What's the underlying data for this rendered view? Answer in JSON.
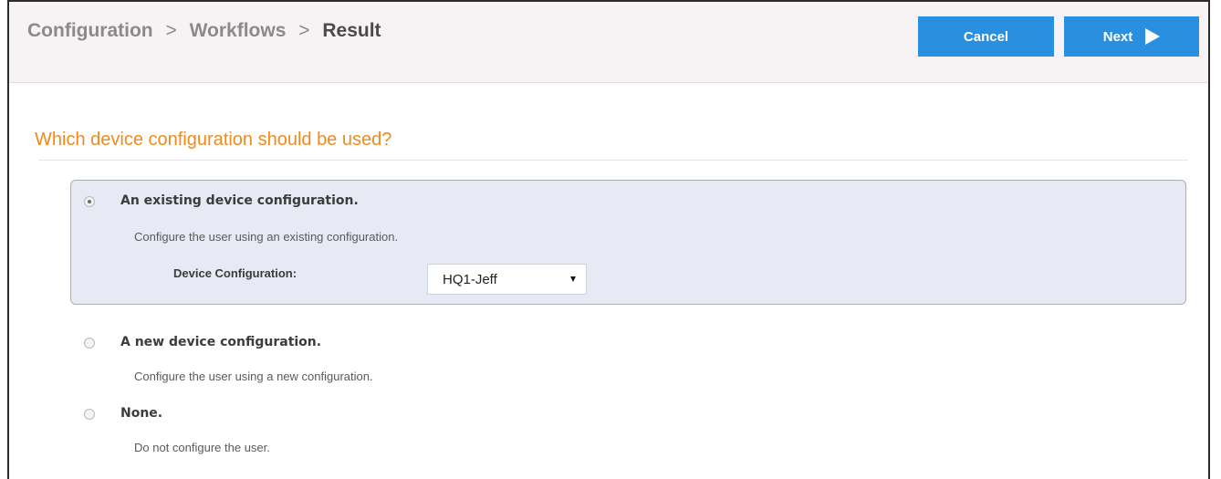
{
  "breadcrumb": {
    "items": [
      "Configuration",
      "Workflows",
      "Result"
    ],
    "separator": ">"
  },
  "actions": {
    "cancel_label": "Cancel",
    "next_label": "Next",
    "next_icon": "play-arrow-icon",
    "accent_color": "#2b8fe0"
  },
  "question": {
    "text": "Which device configuration should be used?",
    "color": "#f08a1c"
  },
  "options": [
    {
      "title": "An existing device configuration.",
      "description": "Configure the user using an existing configuration.",
      "selected": true,
      "field": {
        "label": "Device Configuration:",
        "selected_value": "HQ1-Jeff"
      }
    },
    {
      "title": "A new device configuration.",
      "description": "Configure the user using a new configuration.",
      "selected": false
    },
    {
      "title": "None.",
      "description": "Do not configure the user.",
      "selected": false
    }
  ]
}
